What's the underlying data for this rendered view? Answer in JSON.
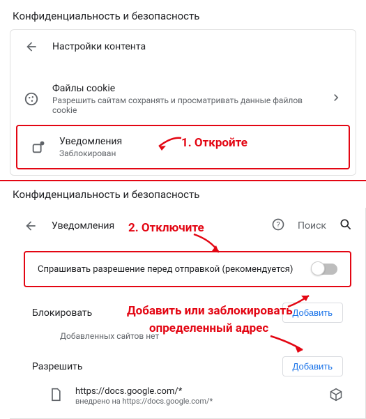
{
  "top": {
    "section_title": "Конфиденциальность и безопасность",
    "back": "Настройки контента",
    "cookies": {
      "title": "Файлы cookie",
      "sub": "Разрешить сайтам сохранять и просматривать данные файлов cookie"
    },
    "notifications": {
      "title": "Уведомления",
      "sub": "Заблокирован"
    }
  },
  "ann1": "1. Откройте",
  "bottom": {
    "section_title": "Конфиденциальность и безопасность",
    "back": "Уведомления",
    "search_placeholder": "Поиск",
    "ask": "Спрашивать разрешение перед отправкой (рекомендуется)",
    "block": "Блокировать",
    "no_sites": "Добавленных сайтов нет",
    "allow": "Разрешить",
    "add": "Добавить",
    "entry": {
      "url": "https://docs.google.com/*",
      "sub": "внедрено на https://docs.google.com/*"
    }
  },
  "ann2": "2. Отключите",
  "ann3a": "Добавить или заблокировать",
  "ann3b": "определенный адрес"
}
